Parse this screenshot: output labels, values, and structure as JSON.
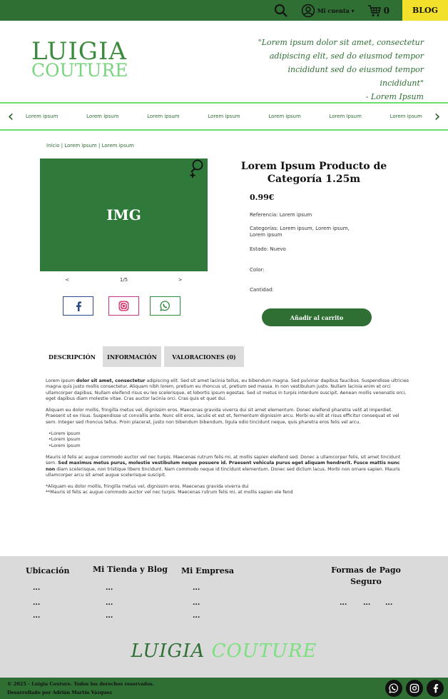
{
  "topbar": {
    "account_label": "Mi cuenta ▾",
    "cart_count": "0",
    "blog_label": "BLOG"
  },
  "header": {
    "logo_line1": "LUIGIA",
    "logo_line2": "COUTURE",
    "quote_lines": [
      "\"Lorem ipsum dolor sit amet, consectetur",
      "adipiscing elit, sed do eiusmod tempor",
      "incididunt sed do eiusmod tempor incididunt\"",
      "- Lorem Ipsum"
    ]
  },
  "nav": {
    "prev_arrow": "‹",
    "next_arrow": "›",
    "items": [
      "Lorem ipsum",
      "Lorem ipsum",
      "Lorem ipsum",
      "Lorem ipsum",
      "Lorem ipsum",
      "Lorem ipsum",
      "Lorem ipsum"
    ]
  },
  "breadcrumb": "Inicio | Lorem ipsum | Lorem ipsum",
  "gallery": {
    "image_label": "IMG",
    "prev": "<",
    "counter": "1/5",
    "next": ">"
  },
  "product": {
    "title": "Lorem Ipsum Producto de Categoría 1.25m",
    "price": "0.99€",
    "reference": "Referencia: Lorem ipsum",
    "categories": "Categorías: Lorem ipsum, Lorem ipsum, Lorem ipsum",
    "state": "Estado: Nuevo",
    "color": "Color:",
    "quantity": "Cantidad:",
    "add_to_cart": "Añadir al carrito"
  },
  "tabs": [
    "DESCRIPCIÓN",
    "INFORMACIÓN",
    "VALORACIONES (0)"
  ],
  "description": {
    "p1_a": "Lorem ipsum ",
    "p1_b": "dolor sit amet, consectetur",
    "p1_c": " adipiscing elit. Sed sit amet lacinia tellus, eu bibendum magna. Sed pulvinar dapibus faucibus. Suspendisse ultricies magna quis justo mollis consectetur. Aliquam nibh lorem, pretium eu rhoncus ut, pretium sed massa. In non vestibulum justo. Nullam lacinia enim et orci ullamcorper dapibus. Nullam eleifend risus eu leo scelerisque, et lobortis ipsum egestas. Sed ut metus in turpis interdum suscipit. Aenean mollis venenatis orci, eget dapibus diam molestie vitae. Cras auctor lacinia orci. Cras quis et quet dui.",
    "p2": "Aliquam eu dolor mollis, fringilla metus vel, dignissim eros. Maecenas gravida viverra dui sit amet elementum. Donec eleifend pharetra velit at imperdiet. Praesent ut ex risus. Suspendisse ut convallis ante. Nunc elit eros, iaculis et est et, fermentum dignissim arcu. Morbi eu elit at risus efficitur consequat et vel sem. Integer sed rhoncus tellus. Proin placerat, justo non bibendum bibendum, ligula odio tincidunt neque, quis pharetra eros felis vel arcu.",
    "list": [
      "Lorem ipsum",
      "Lorem ipsum",
      "Lorem ipsum"
    ],
    "p3_a": "Mauris id felis ac augue commodo auctor vel nec turpis. Maecenas rutrum felis mi, at mollis sapien eleifend sed. Donec a ullamcorper felis, sit amet tincidunt sem. ",
    "p3_b": "Sed maximus metus purus, molestie vestibulum neque posuere id. Praesent vehicula purus eget aliquam hendrerit. Fusce mattis nunc non",
    "p3_c": " diam scelerisque, non tristique libero tincidunt. Nam commodo neque id tincidunt elementum. Donec sed dictum lacus. Morbi non ornare sapien. Mauris ullamcorper arcu sit amet augue scelerisque suscipit.",
    "note1": "*Aliquam eu dolor mollis, fringilla metus vel, dignissim eros. Maecenas gravida viverra dui",
    "note2": "**Mauris id felis ac augue commodo auctor vel nec turpis. Maecenas rutrum felis mi, at mollis sapien ele fend"
  },
  "footer": {
    "col1": "Ubicación",
    "col2": "Mi Tienda y Blog",
    "col3": "Mi Empresa",
    "col4": "Formas de Pago Seguro",
    "dots": "...",
    "brand_1": "LUIGIA",
    "brand_2": "COUTURE",
    "copyright": "© 2025 - Luigia Couture. Todos los derechos reservados.",
    "developer": "Desarrollado por Adrián Martín Vázquez"
  }
}
